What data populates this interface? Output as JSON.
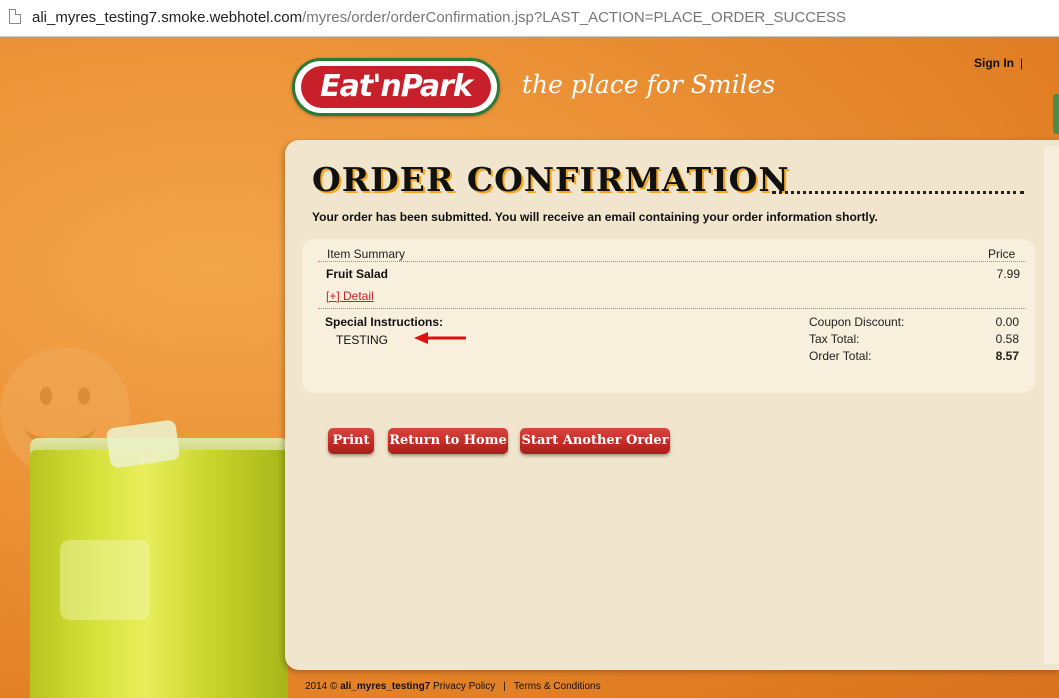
{
  "browser": {
    "url_host": "ali_myres_testing7.smoke.webhotel.com",
    "url_path": "/myres/order/orderConfirmation.jsp?LAST_ACTION=PLACE_ORDER_SUCCESS"
  },
  "header": {
    "logo_text": "Eat'nPark",
    "tagline": "the place for Smiles",
    "sign_in_label": "Sign In",
    "sign_in_separator": "|"
  },
  "confirmation": {
    "title": "ORDER CONFIRMATION",
    "subtitle": "Your order has been submitted. You will receive an email containing your order information shortly."
  },
  "summary": {
    "item_header": "Item Summary",
    "price_header": "Price",
    "items": [
      {
        "name": "Fruit Salad",
        "price": "7.99",
        "detail_link": "[+] Detail"
      }
    ],
    "special_instructions_label": "Special Instructions:",
    "special_instructions_value": "TESTING",
    "totals": [
      {
        "label": "Coupon Discount:",
        "value": "0.00"
      },
      {
        "label": "Tax Total:",
        "value": "0.58"
      },
      {
        "label": "Order Total:",
        "value": "8.57"
      }
    ]
  },
  "actions": {
    "print_label": "Print",
    "return_home_label": "Return to Home",
    "start_another_label": "Start Another Order"
  },
  "footer": {
    "copyright": "2014 ©",
    "username": "ali_myres_testing7",
    "privacy_label": "Privacy Policy",
    "separator": "|",
    "terms_label": "Terms & Conditions"
  },
  "colors": {
    "brand_red": "#c8202a",
    "brand_green": "#2b7a3a",
    "background_orange": "#e88a2c",
    "panel": "#f1e6cd"
  }
}
